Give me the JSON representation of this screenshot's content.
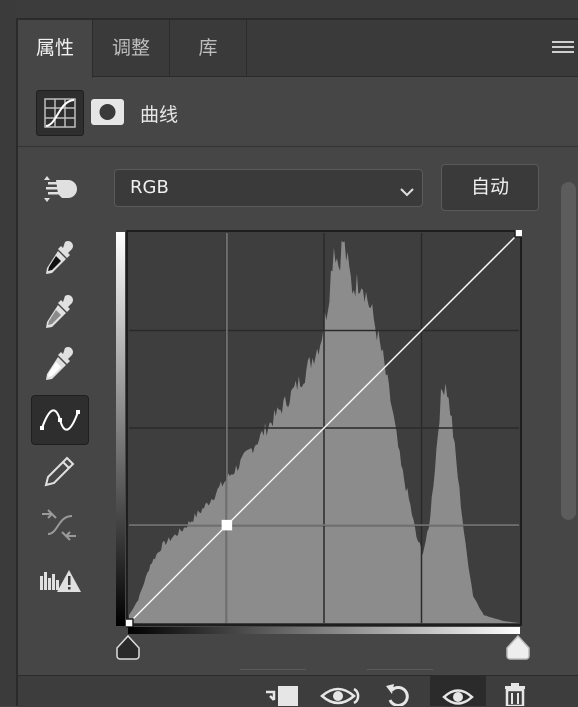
{
  "tabs": [
    {
      "label": "属性",
      "active": true
    },
    {
      "label": "调整",
      "active": false
    },
    {
      "label": "库",
      "active": false
    }
  ],
  "header": {
    "title": "曲线",
    "icons": [
      "curves-adjustment-icon",
      "layer-mask-icon"
    ]
  },
  "tools": [
    "on-image-adjust-icon",
    "black-point-eyedropper-icon",
    "gray-point-eyedropper-icon",
    "white-point-eyedropper-icon",
    "curve-point-tool-icon",
    "pencil-icon",
    "smooth-curve-icon",
    "clipping-warning-icon"
  ],
  "active_tool": "curve-point-tool-icon",
  "channel": {
    "selected": "RGB"
  },
  "auto_label": "自动",
  "curve": {
    "points": [
      [
        0,
        0
      ],
      [
        64,
        64
      ],
      [
        255,
        255
      ]
    ],
    "range": [
      0,
      255
    ]
  },
  "bottom_actions": [
    "clip-to-layer-icon",
    "view-previous-state-icon",
    "reset-icon",
    "visibility-eye-icon",
    "trash-icon"
  ],
  "colors": {
    "panel_bg": "#464646",
    "graph_bg": "#3e3e3e",
    "histogram": "#8c8c8c",
    "curve": "#ffffff"
  }
}
